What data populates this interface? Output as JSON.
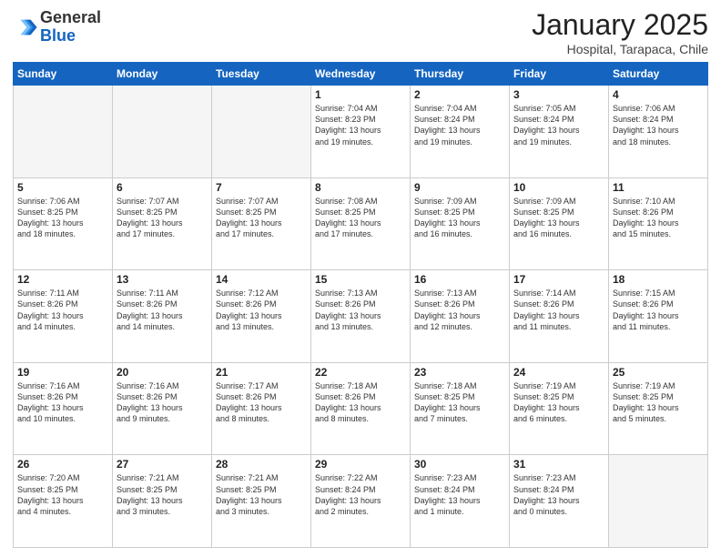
{
  "logo": {
    "general": "General",
    "blue": "Blue"
  },
  "title": "January 2025",
  "subtitle": "Hospital, Tarapaca, Chile",
  "headers": [
    "Sunday",
    "Monday",
    "Tuesday",
    "Wednesday",
    "Thursday",
    "Friday",
    "Saturday"
  ],
  "weeks": [
    [
      {
        "day": "",
        "info": ""
      },
      {
        "day": "",
        "info": ""
      },
      {
        "day": "",
        "info": ""
      },
      {
        "day": "1",
        "info": "Sunrise: 7:04 AM\nSunset: 8:23 PM\nDaylight: 13 hours\nand 19 minutes."
      },
      {
        "day": "2",
        "info": "Sunrise: 7:04 AM\nSunset: 8:24 PM\nDaylight: 13 hours\nand 19 minutes."
      },
      {
        "day": "3",
        "info": "Sunrise: 7:05 AM\nSunset: 8:24 PM\nDaylight: 13 hours\nand 19 minutes."
      },
      {
        "day": "4",
        "info": "Sunrise: 7:06 AM\nSunset: 8:24 PM\nDaylight: 13 hours\nand 18 minutes."
      }
    ],
    [
      {
        "day": "5",
        "info": "Sunrise: 7:06 AM\nSunset: 8:25 PM\nDaylight: 13 hours\nand 18 minutes."
      },
      {
        "day": "6",
        "info": "Sunrise: 7:07 AM\nSunset: 8:25 PM\nDaylight: 13 hours\nand 17 minutes."
      },
      {
        "day": "7",
        "info": "Sunrise: 7:07 AM\nSunset: 8:25 PM\nDaylight: 13 hours\nand 17 minutes."
      },
      {
        "day": "8",
        "info": "Sunrise: 7:08 AM\nSunset: 8:25 PM\nDaylight: 13 hours\nand 17 minutes."
      },
      {
        "day": "9",
        "info": "Sunrise: 7:09 AM\nSunset: 8:25 PM\nDaylight: 13 hours\nand 16 minutes."
      },
      {
        "day": "10",
        "info": "Sunrise: 7:09 AM\nSunset: 8:25 PM\nDaylight: 13 hours\nand 16 minutes."
      },
      {
        "day": "11",
        "info": "Sunrise: 7:10 AM\nSunset: 8:26 PM\nDaylight: 13 hours\nand 15 minutes."
      }
    ],
    [
      {
        "day": "12",
        "info": "Sunrise: 7:11 AM\nSunset: 8:26 PM\nDaylight: 13 hours\nand 14 minutes."
      },
      {
        "day": "13",
        "info": "Sunrise: 7:11 AM\nSunset: 8:26 PM\nDaylight: 13 hours\nand 14 minutes."
      },
      {
        "day": "14",
        "info": "Sunrise: 7:12 AM\nSunset: 8:26 PM\nDaylight: 13 hours\nand 13 minutes."
      },
      {
        "day": "15",
        "info": "Sunrise: 7:13 AM\nSunset: 8:26 PM\nDaylight: 13 hours\nand 13 minutes."
      },
      {
        "day": "16",
        "info": "Sunrise: 7:13 AM\nSunset: 8:26 PM\nDaylight: 13 hours\nand 12 minutes."
      },
      {
        "day": "17",
        "info": "Sunrise: 7:14 AM\nSunset: 8:26 PM\nDaylight: 13 hours\nand 11 minutes."
      },
      {
        "day": "18",
        "info": "Sunrise: 7:15 AM\nSunset: 8:26 PM\nDaylight: 13 hours\nand 11 minutes."
      }
    ],
    [
      {
        "day": "19",
        "info": "Sunrise: 7:16 AM\nSunset: 8:26 PM\nDaylight: 13 hours\nand 10 minutes."
      },
      {
        "day": "20",
        "info": "Sunrise: 7:16 AM\nSunset: 8:26 PM\nDaylight: 13 hours\nand 9 minutes."
      },
      {
        "day": "21",
        "info": "Sunrise: 7:17 AM\nSunset: 8:26 PM\nDaylight: 13 hours\nand 8 minutes."
      },
      {
        "day": "22",
        "info": "Sunrise: 7:18 AM\nSunset: 8:26 PM\nDaylight: 13 hours\nand 8 minutes."
      },
      {
        "day": "23",
        "info": "Sunrise: 7:18 AM\nSunset: 8:25 PM\nDaylight: 13 hours\nand 7 minutes."
      },
      {
        "day": "24",
        "info": "Sunrise: 7:19 AM\nSunset: 8:25 PM\nDaylight: 13 hours\nand 6 minutes."
      },
      {
        "day": "25",
        "info": "Sunrise: 7:19 AM\nSunset: 8:25 PM\nDaylight: 13 hours\nand 5 minutes."
      }
    ],
    [
      {
        "day": "26",
        "info": "Sunrise: 7:20 AM\nSunset: 8:25 PM\nDaylight: 13 hours\nand 4 minutes."
      },
      {
        "day": "27",
        "info": "Sunrise: 7:21 AM\nSunset: 8:25 PM\nDaylight: 13 hours\nand 3 minutes."
      },
      {
        "day": "28",
        "info": "Sunrise: 7:21 AM\nSunset: 8:25 PM\nDaylight: 13 hours\nand 3 minutes."
      },
      {
        "day": "29",
        "info": "Sunrise: 7:22 AM\nSunset: 8:24 PM\nDaylight: 13 hours\nand 2 minutes."
      },
      {
        "day": "30",
        "info": "Sunrise: 7:23 AM\nSunset: 8:24 PM\nDaylight: 13 hours\nand 1 minute."
      },
      {
        "day": "31",
        "info": "Sunrise: 7:23 AM\nSunset: 8:24 PM\nDaylight: 13 hours\nand 0 minutes."
      },
      {
        "day": "",
        "info": ""
      }
    ]
  ]
}
